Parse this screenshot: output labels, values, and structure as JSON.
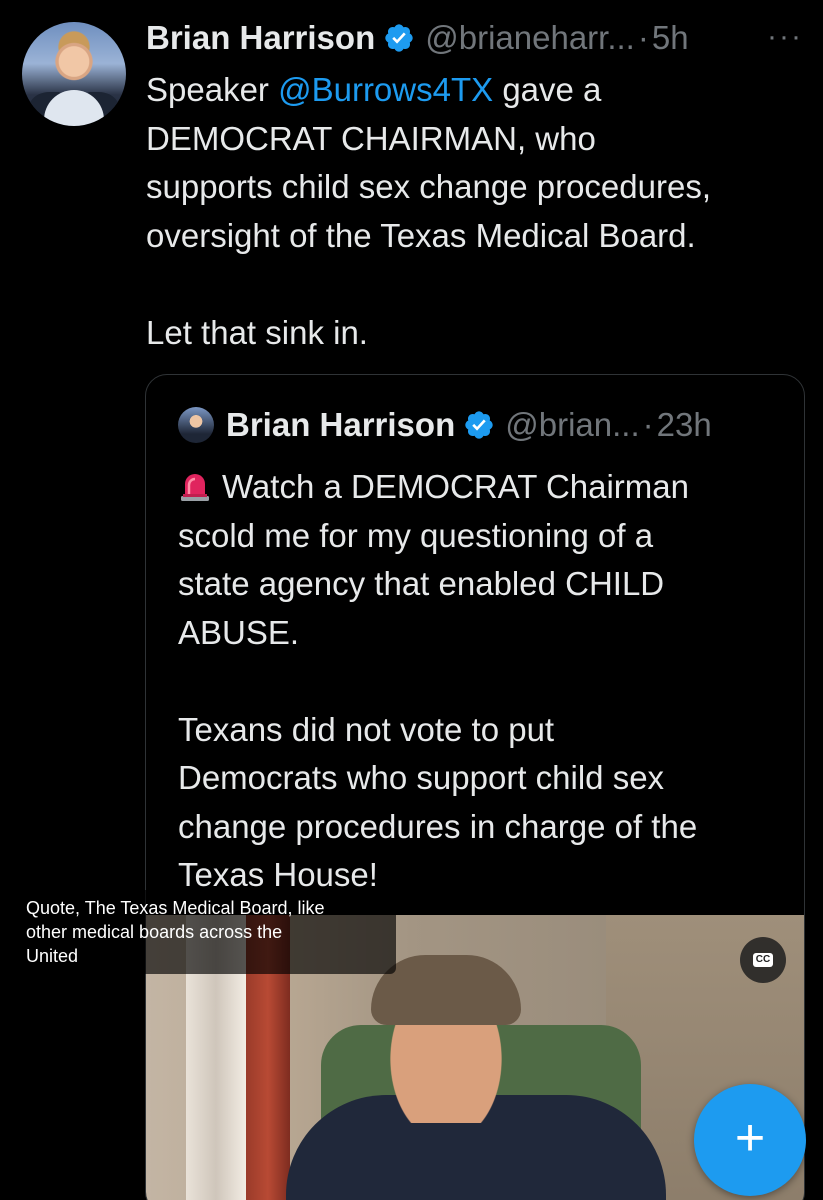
{
  "tweet": {
    "author_name": "Brian Harrison",
    "handle": "@brianeharr...",
    "separator": "·",
    "time": "5h",
    "more_label": "···",
    "text_before_mention": "Speaker ",
    "mention": "@Burrows4TX",
    "text_after_mention": " gave a\nDEMOCRAT CHAIRMAN, who\nsupports child sex change procedures,\noversight of the Texas Medical Board.\n\nLet that sink in."
  },
  "quoted_tweet": {
    "author_name": "Brian Harrison",
    "handle": "@brian...",
    "separator": "·",
    "time": "23h",
    "emoji": "siren-icon",
    "text": "Watch a DEMOCRAT Chairman\nscold me for my questioning of a\nstate agency that enabled CHILD\nABUSE.\n\nTexans did not vote to put\nDemocrats who support child sex\nchange procedures in charge of the\nTexas House!",
    "video": {
      "cc_label": "CC",
      "caption": "Quote, The Texas Medical Board, like\nother medical boards across the\nUnited"
    }
  },
  "fab": {
    "label": "+"
  },
  "colors": {
    "background": "#000000",
    "text": "#e7e9ea",
    "secondary": "#71767b",
    "accent": "#1d9bf0",
    "border": "#2f3336"
  }
}
